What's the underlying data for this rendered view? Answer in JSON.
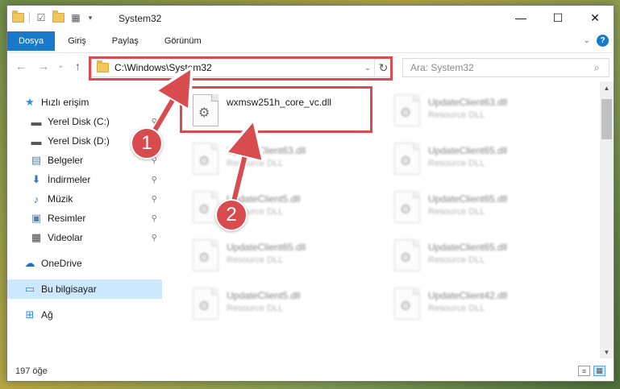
{
  "window": {
    "title": "System32",
    "controls": {
      "minimize": "—",
      "maximize": "☐",
      "close": "✕"
    }
  },
  "ribbon": {
    "tabs": [
      "Dosya",
      "Giriş",
      "Paylaş",
      "Görünüm"
    ],
    "expand_glyph": "⌄",
    "help": "?"
  },
  "nav": {
    "back": "←",
    "forward": "→",
    "recent": "⌄",
    "up": "↑"
  },
  "address": {
    "path": "C:\\Windows\\System32",
    "dropdown": "⌄",
    "refresh": "↻"
  },
  "search": {
    "placeholder": "Ara: System32",
    "icon": "search-icon"
  },
  "sidebar": {
    "items": [
      {
        "label": "Hızlı erişim",
        "icon": "star-icon",
        "glyph": "★",
        "color": "#2e8ee2",
        "pinned": false,
        "selected": false
      },
      {
        "label": "Yerel Disk (C:)",
        "icon": "drive-icon",
        "glyph": "▬",
        "color": "#555555",
        "pinned": true,
        "selected": false
      },
      {
        "label": "Yerel Disk (D:)",
        "icon": "drive-icon",
        "glyph": "▬",
        "color": "#555555",
        "pinned": true,
        "selected": false
      },
      {
        "label": "Belgeler",
        "icon": "document-icon",
        "glyph": "▤",
        "color": "#5a7fa8",
        "pinned": true,
        "selected": false
      },
      {
        "label": "İndirmeler",
        "icon": "download-icon",
        "glyph": "⬇",
        "color": "#2e7ad1",
        "pinned": true,
        "selected": false
      },
      {
        "label": "Müzik",
        "icon": "music-icon",
        "glyph": "♪",
        "color": "#2e7ad1",
        "pinned": true,
        "selected": false
      },
      {
        "label": "Resimler",
        "icon": "picture-icon",
        "glyph": "▣",
        "color": "#5a7fa8",
        "pinned": true,
        "selected": false
      },
      {
        "label": "Videolar",
        "icon": "video-icon",
        "glyph": "▦",
        "color": "#444444",
        "pinned": true,
        "selected": false
      },
      {
        "label": "OneDrive",
        "icon": "cloud-icon",
        "glyph": "☁",
        "color": "#1e6fc7",
        "pinned": false,
        "selected": false
      },
      {
        "label": "Bu bilgisayar",
        "icon": "computer-icon",
        "glyph": "▭",
        "color": "#2e8ee2",
        "pinned": false,
        "selected": true
      },
      {
        "label": "Ağ",
        "icon": "network-icon",
        "glyph": "⊞",
        "color": "#2e8ee2",
        "pinned": false,
        "selected": false
      }
    ],
    "pin_glyph": "📌"
  },
  "files": [
    {
      "name": "wxmsw251h_core_vc.dll",
      "type": "",
      "highlight": true
    },
    {
      "name": "UpdateClient63.dll",
      "type": "Resource DLL",
      "highlight": false
    },
    {
      "name": "UpdateClient63.dll",
      "type": "Resource DLL",
      "highlight": false
    },
    {
      "name": "UpdateClient65.dll",
      "type": "Resource DLL",
      "highlight": false
    },
    {
      "name": "UpdateClient5.dll",
      "type": "Resource DLL",
      "highlight": false
    },
    {
      "name": "UpdateClient65.dll",
      "type": "Resource DLL",
      "highlight": false
    },
    {
      "name": "UpdateClient65.dll",
      "type": "Resource DLL",
      "highlight": false
    },
    {
      "name": "UpdateClient65.dll",
      "type": "Resource DLL",
      "highlight": false
    },
    {
      "name": "UpdateClient5.dll",
      "type": "Resource DLL",
      "highlight": false
    },
    {
      "name": "UpdateClient42.dll",
      "type": "Resource DLL",
      "highlight": false
    }
  ],
  "status": {
    "count": "197 öğe"
  },
  "annotations": {
    "badge1": "1",
    "badge2": "2",
    "color": "#d84b4f"
  }
}
